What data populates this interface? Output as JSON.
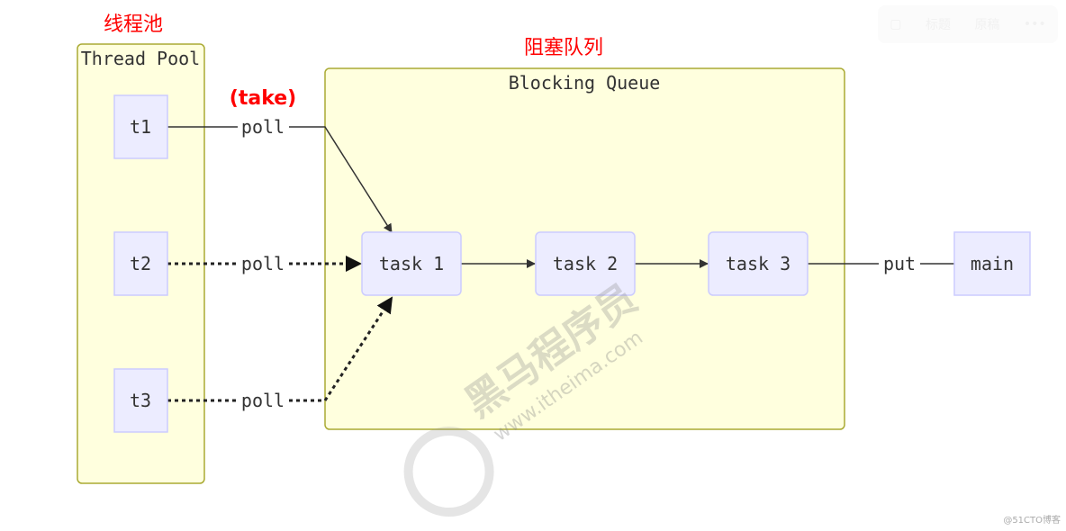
{
  "labels": {
    "thread_pool_cn": "线程池",
    "blocking_queue_cn": "阻塞队列",
    "take": "(take)"
  },
  "thread_pool": {
    "title": "Thread Pool",
    "threads": [
      "t1",
      "t2",
      "t3"
    ]
  },
  "blocking_queue": {
    "title": "Blocking Queue",
    "tasks": [
      "task 1",
      "task 2",
      "task 3"
    ]
  },
  "producer": "main",
  "edges": {
    "poll": "poll",
    "put": "put"
  },
  "toolbar": {
    "items": [
      "标题",
      "原稿",
      "•••"
    ]
  },
  "watermark": {
    "brand": "黑马程序员",
    "url": "www.itheima.com"
  },
  "credit": "@51CTO博客",
  "colors": {
    "cluster_fill": "#ffffde",
    "cluster_stroke": "#aaaa33",
    "node_fill": "#ececff",
    "node_stroke": "#ccccff",
    "annotation": "#ff0000"
  }
}
